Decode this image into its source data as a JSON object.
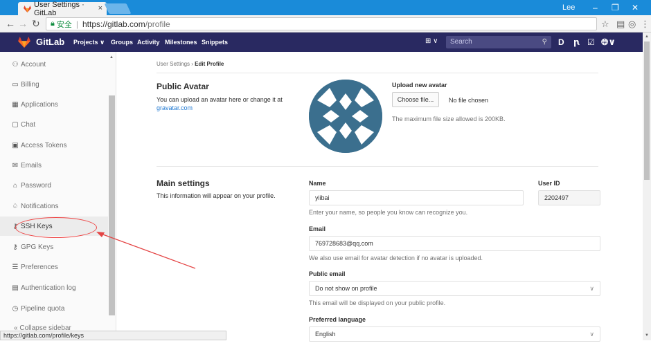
{
  "browser": {
    "tab_title": "User Settings · GitLab",
    "tab_close": "×",
    "user_name": "Lee",
    "url_secure_label": "安全",
    "url_host": "https://gitlab.com",
    "url_path": "/profile"
  },
  "gitlab_nav": {
    "brand": "GitLab",
    "links": [
      "Projects ∨",
      "Groups",
      "Activity",
      "Milestones",
      "Snippets"
    ],
    "search_placeholder": "Search"
  },
  "sidebar": {
    "items": [
      {
        "label": "Account",
        "icon": "account-icon"
      },
      {
        "label": "Billing",
        "icon": "billing-icon"
      },
      {
        "label": "Applications",
        "icon": "applications-icon"
      },
      {
        "label": "Chat",
        "icon": "chat-icon"
      },
      {
        "label": "Access Tokens",
        "icon": "token-icon"
      },
      {
        "label": "Emails",
        "icon": "email-icon"
      },
      {
        "label": "Password",
        "icon": "lock-icon"
      },
      {
        "label": "Notifications",
        "icon": "bell-icon"
      },
      {
        "label": "SSH Keys",
        "icon": "key-icon"
      },
      {
        "label": "GPG Keys",
        "icon": "key-icon"
      },
      {
        "label": "Preferences",
        "icon": "sliders-icon"
      },
      {
        "label": "Authentication log",
        "icon": "log-icon"
      },
      {
        "label": "Pipeline quota",
        "icon": "clock-icon"
      }
    ],
    "collapse_label": "Collapse sidebar"
  },
  "status_url": "https://gitlab.com/profile/keys",
  "breadcrumb": {
    "parent": "User Settings",
    "current": "Edit Profile"
  },
  "avatar_section": {
    "title": "Public Avatar",
    "desc_line1": "You can upload an avatar here or change it at",
    "gravatar_link": "gravatar.com",
    "upload_title": "Upload new avatar",
    "choose_button": "Choose file...",
    "no_file": "No file chosen",
    "max_size": "The maximum file size allowed is 200KB."
  },
  "main_settings": {
    "title": "Main settings",
    "desc": "This information will appear on your profile.",
    "name_label": "Name",
    "name_value": "yiibai",
    "name_help": "Enter your name, so people you know can recognize you.",
    "userid_label": "User ID",
    "userid_value": "2202497",
    "email_label": "Email",
    "email_value": "769728683@qq.com",
    "email_help": "We also use email for avatar detection if no avatar is uploaded.",
    "public_email_label": "Public email",
    "public_email_value": "Do not show on profile",
    "public_email_help": "This email will be displayed on your public profile.",
    "language_label": "Preferred language",
    "language_value": "English"
  },
  "colors": {
    "nav_bg": "#292961",
    "browser_blue": "#1a8bd9",
    "link": "#1f78d1",
    "annotation_red": "#e44444"
  }
}
